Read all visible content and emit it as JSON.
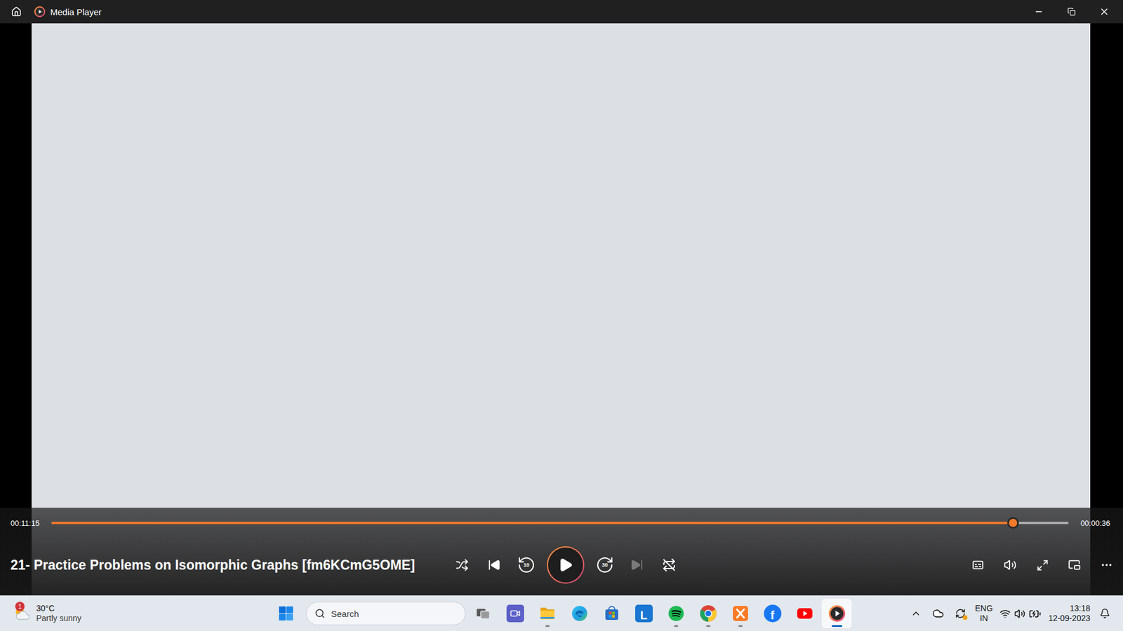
{
  "window": {
    "title": "Media Player"
  },
  "video": {
    "title": "21- Practice Problems on Isomorphic Graphs [fm6KCmG5OME]"
  },
  "seek": {
    "elapsed": "00:11:15",
    "remaining": "00:00:36",
    "level": 0.945
  },
  "controls": {
    "playing": false,
    "shuffle": false,
    "repeat": false,
    "skip_back": "10",
    "skip_forward": "30",
    "previous_disabled": false,
    "next_disabled": true
  },
  "taskbar": {
    "weather": {
      "temperature": "30°C",
      "condition": "Partly sunny",
      "badge": "1"
    },
    "search": {
      "placeholder": "Search"
    },
    "apps": [
      {
        "kind": "taskview",
        "running": false,
        "active": false
      },
      {
        "kind": "meet",
        "running": false,
        "active": false
      },
      {
        "kind": "explorer",
        "running": true,
        "active": false
      },
      {
        "kind": "edge",
        "running": false,
        "active": false
      },
      {
        "kind": "store",
        "running": false,
        "active": false
      },
      {
        "kind": "letter",
        "label": "L",
        "running": false,
        "active": false
      },
      {
        "kind": "spotify",
        "running": true,
        "active": false
      },
      {
        "kind": "chrome",
        "running": true,
        "active": false
      },
      {
        "kind": "xampp",
        "running": true,
        "active": false
      },
      {
        "kind": "facebook",
        "label": "f",
        "running": false,
        "active": false
      },
      {
        "kind": "youtube",
        "running": false,
        "active": false
      },
      {
        "kind": "mediaplayer",
        "running": true,
        "active": true
      }
    ],
    "tray": {
      "language": "ENG",
      "region": "IN",
      "time": "13:18",
      "date": "12-09-2023"
    }
  }
}
